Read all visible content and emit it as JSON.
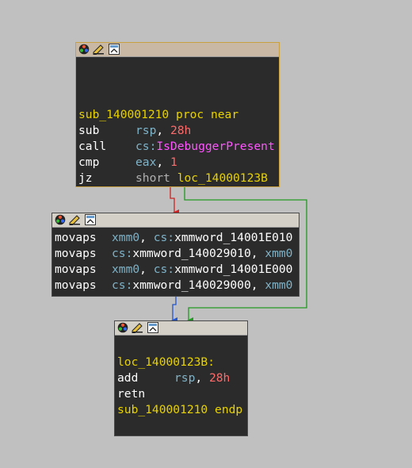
{
  "colors": {
    "background": "#c0c0c0",
    "node_bg": "#2b2b2b",
    "edge_false": "#cc2222",
    "edge_true": "#229922",
    "edge_flow": "#2255cc"
  },
  "header_icons": [
    "color-palette-icon",
    "edit-pencil-icon",
    "graph-overview-icon"
  ],
  "block1": {
    "proc_name": "sub_140001210",
    "proc_kw": "proc near",
    "l1": {
      "mn": "sub",
      "reg": "rsp",
      "comma": ", ",
      "num": "28h"
    },
    "l2": {
      "mn": "call",
      "seg": "cs:",
      "func": "IsDebuggerPresent"
    },
    "l3": {
      "mn": "cmp",
      "reg": "eax",
      "comma": ", ",
      "num": "1"
    },
    "l4": {
      "mn": "jz",
      "kw": "short",
      "target": "loc_14000123B"
    }
  },
  "block2": {
    "lines": [
      {
        "mn": "movaps",
        "a": "xmm0",
        "b": ", ",
        "c": "cs:",
        "d": "xmmword_14001E010"
      },
      {
        "mn": "movaps",
        "a": "cs:",
        "b": "xmmword_140029010",
        "c": ", ",
        "d": "xmm0"
      },
      {
        "mn": "movaps",
        "a": "xmm0",
        "b": ", ",
        "c": "cs:",
        "d": "xmmword_14001E000"
      },
      {
        "mn": "movaps",
        "a": "cs:",
        "b": "xmmword_140029000",
        "c": ", ",
        "d": "xmm0"
      }
    ]
  },
  "block3": {
    "label": "loc_14000123B:",
    "l1": {
      "mn": "add",
      "reg": "rsp",
      "comma": ", ",
      "num": "28h"
    },
    "l2": {
      "mn": "retn"
    },
    "endp_name": "sub_140001210",
    "endp_kw": "endp"
  }
}
